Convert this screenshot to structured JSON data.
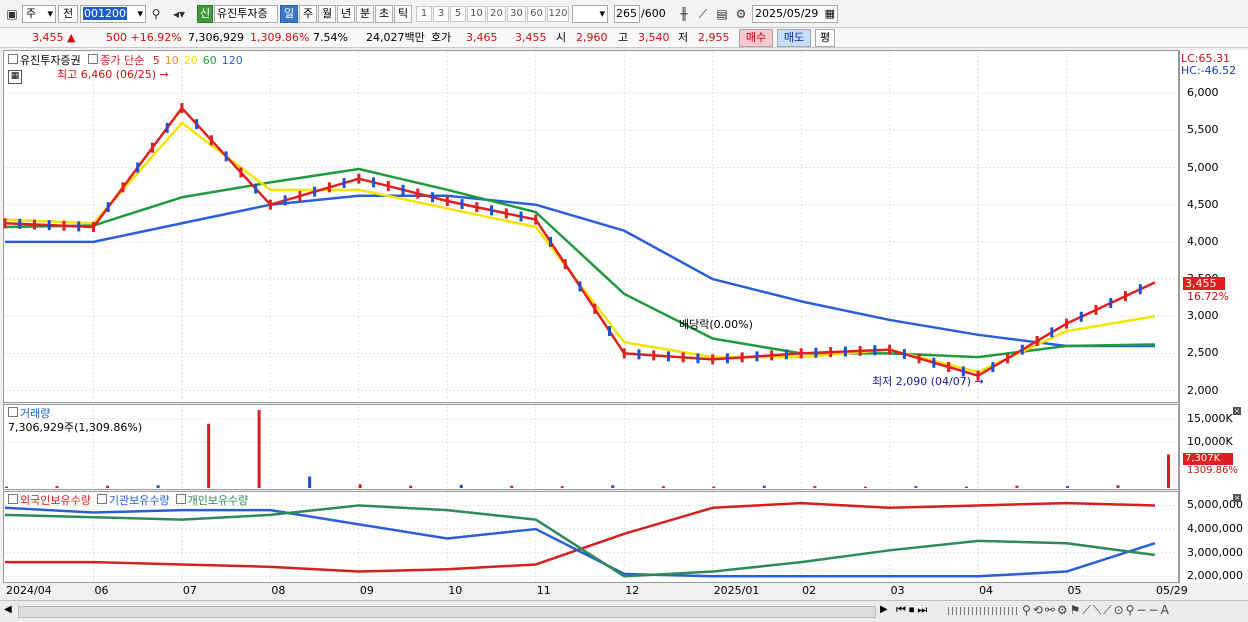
{
  "toolbar": {
    "type_sel": "주",
    "prev_label": "전",
    "code": "001200",
    "stock_name": "유진투자증",
    "new_badge": "신",
    "periods": [
      "일",
      "주",
      "월",
      "년",
      "분",
      "초",
      "틱"
    ],
    "active_period": "일",
    "nums": [
      "1",
      "3",
      "5",
      "10",
      "20",
      "30",
      "60",
      "120"
    ],
    "count": "265",
    "count_max": "/600",
    "date": "2025/05/29"
  },
  "quote": {
    "price": "3,455",
    "change": "500 +16.92%",
    "volume": "7,306,929",
    "vol_pct": "1,309.86%",
    "turnover": "7.54%",
    "amount": "24,027백만",
    "hoga_label": "호가",
    "ask": "3,465",
    "bid": "3,455",
    "open_label": "시",
    "open": "2,960",
    "high_label": "고",
    "high": "3,540",
    "low_label": "저",
    "low": "2,955",
    "buy_label": "매수",
    "sell_label": "매도",
    "avg_label": "평"
  },
  "price_panel": {
    "name": "유진투자증권",
    "ma_label": "종가 단순",
    "ma_periods": [
      "5",
      "10",
      "20",
      "60",
      "120"
    ],
    "ma_colors": [
      "#e02020",
      "#f08c1e",
      "#f5e300",
      "#1f9a3c",
      "#2b5fd9"
    ],
    "high_note": "최고 6,460 (06/25)",
    "low_note": "최저 2,090 (04/07)",
    "dividend_note": "배당락(0.00%)",
    "lc": "LC:65.31",
    "hc": "HC:-46.52",
    "last_price": "3,455",
    "last_pct": "16.72%"
  },
  "volume_panel": {
    "title": "거래량",
    "value": "7,306,929주(1,309.86%)",
    "last_val": "7,307K",
    "last_pct": "1309.86%"
  },
  "holdings_panel": {
    "legend": [
      "외국인보유수량",
      "기관보유수량",
      "개인보유수량"
    ],
    "colors": [
      "#d42020",
      "#2a5fd8",
      "#2e8b57"
    ]
  },
  "x_axis": [
    "2024/04",
    "06",
    "07",
    "08",
    "09",
    "10",
    "11",
    "12",
    "2025/01",
    "02",
    "03",
    "04",
    "05",
    "05/29"
  ],
  "y_axis_price": [
    "6,000",
    "5,500",
    "5,000",
    "4,500",
    "4,000",
    "3,500",
    "3,000",
    "2,500",
    "2,000"
  ],
  "y_axis_volume": [
    "15,000K",
    "10,000K"
  ],
  "y_axis_holdings": [
    "5,000,000",
    "4,000,000",
    "3,000,000",
    "2,000,000"
  ],
  "chart_data": [
    {
      "type": "line",
      "title": "유진투자증권",
      "x": [
        "2024/04",
        "06",
        "07",
        "08",
        "09",
        "10",
        "11",
        "12",
        "2025/01",
        "02",
        "03",
        "04",
        "05",
        "05/29"
      ],
      "ylim": [
        1900,
        6500
      ],
      "series": [
        {
          "name": "5",
          "values": [
            4250,
            4200,
            5800,
            4500,
            4850,
            4550,
            4300,
            2500,
            2420,
            2500,
            2550,
            2200,
            2900,
            3455
          ]
        },
        {
          "name": "20",
          "values": [
            4300,
            4250,
            5600,
            4700,
            4700,
            4450,
            4200,
            2650,
            2450,
            2450,
            2550,
            2250,
            2800,
            3000
          ]
        },
        {
          "name": "60",
          "values": [
            4200,
            4220,
            4600,
            4800,
            4980,
            4700,
            4400,
            3300,
            2700,
            2500,
            2500,
            2450,
            2600,
            2620
          ]
        },
        {
          "name": "120",
          "values": [
            4000,
            4000,
            4250,
            4500,
            4620,
            4620,
            4500,
            4150,
            3500,
            3200,
            2950,
            2750,
            2600,
            2600
          ]
        }
      ]
    },
    {
      "type": "bar",
      "title": "거래량",
      "ylim": [
        0,
        17000
      ],
      "values": [
        300,
        400,
        500,
        600,
        14000,
        17000,
        2500,
        800,
        500,
        700,
        500,
        400,
        600,
        400,
        300,
        500,
        400,
        300,
        400,
        300,
        500,
        400,
        600,
        7307
      ]
    },
    {
      "type": "line",
      "x": [
        "2024/04",
        "06",
        "07",
        "08",
        "09",
        "10",
        "11",
        "12",
        "2025/01",
        "02",
        "03",
        "04",
        "05",
        "05/29"
      ],
      "ylim": [
        1800000,
        5400000
      ],
      "series": [
        {
          "name": "외국인보유수량",
          "values": [
            2600000,
            2600000,
            2500000,
            2400000,
            2200000,
            2300000,
            2500000,
            3800000,
            4900000,
            5100000,
            4900000,
            5000000,
            5100000,
            5000000
          ]
        },
        {
          "name": "기관보유수량",
          "values": [
            4900000,
            4700000,
            4800000,
            4800000,
            4200000,
            3600000,
            4000000,
            2100000,
            2000000,
            2000000,
            2000000,
            2000000,
            2200000,
            3400000
          ]
        },
        {
          "name": "개인보유수량",
          "values": [
            4600000,
            4500000,
            4400000,
            4600000,
            5000000,
            4800000,
            4400000,
            2000000,
            2200000,
            2600000,
            3100000,
            3500000,
            3400000,
            2900000
          ]
        }
      ]
    }
  ]
}
